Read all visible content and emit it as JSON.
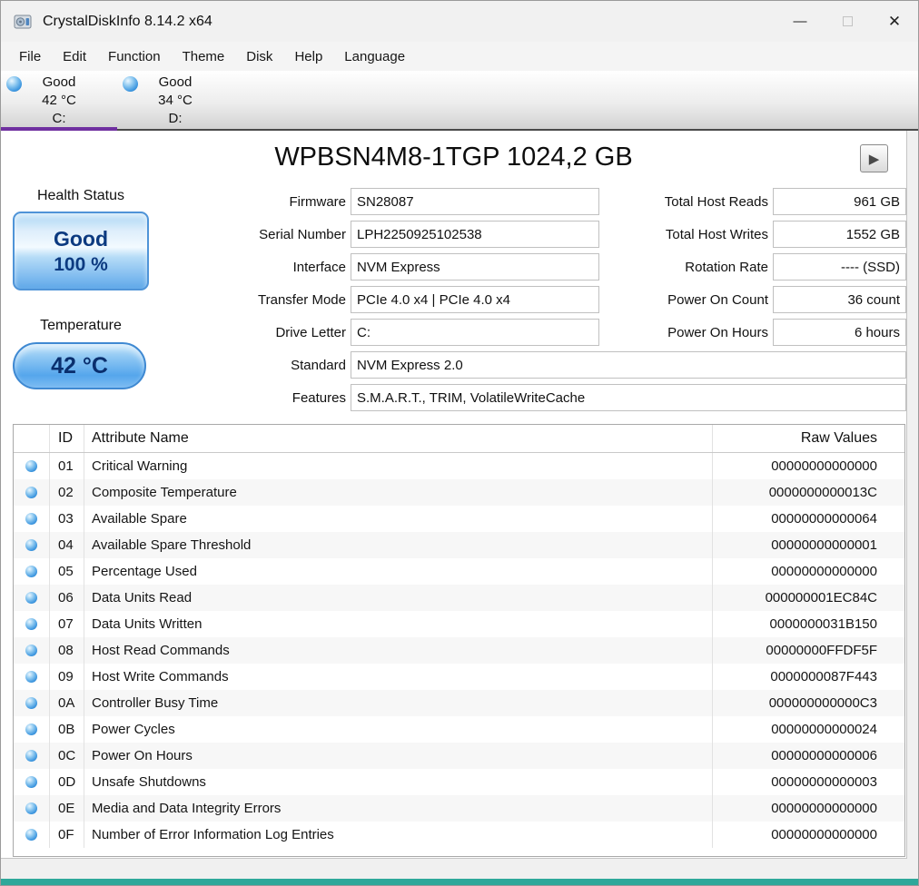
{
  "window": {
    "title": "CrystalDiskInfo 8.14.2 x64",
    "controls": {
      "minimize": "—",
      "close": "✕"
    }
  },
  "menu": {
    "items": [
      "File",
      "Edit",
      "Function",
      "Theme",
      "Disk",
      "Help",
      "Language"
    ]
  },
  "drives": [
    {
      "status": "Good",
      "temp": "42 °C",
      "letter": "C:",
      "selected": true
    },
    {
      "status": "Good",
      "temp": "34 °C",
      "letter": "D:",
      "selected": false
    }
  ],
  "main": {
    "model": "WPBSN4M8-1TGP 1024,2 GB",
    "play_icon": "▶",
    "health": {
      "label": "Health Status",
      "status": "Good",
      "percent": "100 %"
    },
    "temperature": {
      "label": "Temperature",
      "value": "42 °C"
    },
    "info_fields": [
      {
        "label": "Firmware",
        "value": "SN28087"
      },
      {
        "label": "Serial Number",
        "value": "LPH2250925102538"
      },
      {
        "label": "Interface",
        "value": "NVM Express"
      },
      {
        "label": "Transfer Mode",
        "value": "PCIe 4.0 x4 | PCIe 4.0 x4"
      },
      {
        "label": "Drive Letter",
        "value": "C:"
      },
      {
        "label": "Standard",
        "value": "NVM Express 2.0"
      },
      {
        "label": "Features",
        "value": "S.M.A.R.T., TRIM, VolatileWriteCache"
      }
    ],
    "stats_fields": [
      {
        "label": "Total Host Reads",
        "value": "961 GB"
      },
      {
        "label": "Total Host Writes",
        "value": "1552 GB"
      },
      {
        "label": "Rotation Rate",
        "value": "---- (SSD)"
      },
      {
        "label": "Power On Count",
        "value": "36 count"
      },
      {
        "label": "Power On Hours",
        "value": "6 hours"
      }
    ]
  },
  "table": {
    "headers": {
      "id": "ID",
      "name": "Attribute Name",
      "raw": "Raw Values"
    },
    "rows": [
      {
        "id": "01",
        "name": "Critical Warning",
        "raw": "00000000000000"
      },
      {
        "id": "02",
        "name": "Composite Temperature",
        "raw": "0000000000013C"
      },
      {
        "id": "03",
        "name": "Available Spare",
        "raw": "00000000000064"
      },
      {
        "id": "04",
        "name": "Available Spare Threshold",
        "raw": "00000000000001"
      },
      {
        "id": "05",
        "name": "Percentage Used",
        "raw": "00000000000000"
      },
      {
        "id": "06",
        "name": "Data Units Read",
        "raw": "000000001EC84C"
      },
      {
        "id": "07",
        "name": "Data Units Written",
        "raw": "0000000031B150"
      },
      {
        "id": "08",
        "name": "Host Read Commands",
        "raw": "00000000FFDF5F"
      },
      {
        "id": "09",
        "name": "Host Write Commands",
        "raw": "0000000087F443"
      },
      {
        "id": "0A",
        "name": "Controller Busy Time",
        "raw": "000000000000C3"
      },
      {
        "id": "0B",
        "name": "Power Cycles",
        "raw": "00000000000024"
      },
      {
        "id": "0C",
        "name": "Power On Hours",
        "raw": "00000000000006"
      },
      {
        "id": "0D",
        "name": "Unsafe Shutdowns",
        "raw": "00000000000003"
      },
      {
        "id": "0E",
        "name": "Media and Data Integrity Errors",
        "raw": "00000000000000"
      },
      {
        "id": "0F",
        "name": "Number of Error Information Log Entries",
        "raw": "00000000000000"
      }
    ]
  },
  "colors": {
    "selected_tab_underline": "#7030a0",
    "bottom_accent_bar": "#2ea89a",
    "health_good_blue": "#5fa8e8",
    "status_orb_blue": "#3e97e0"
  }
}
